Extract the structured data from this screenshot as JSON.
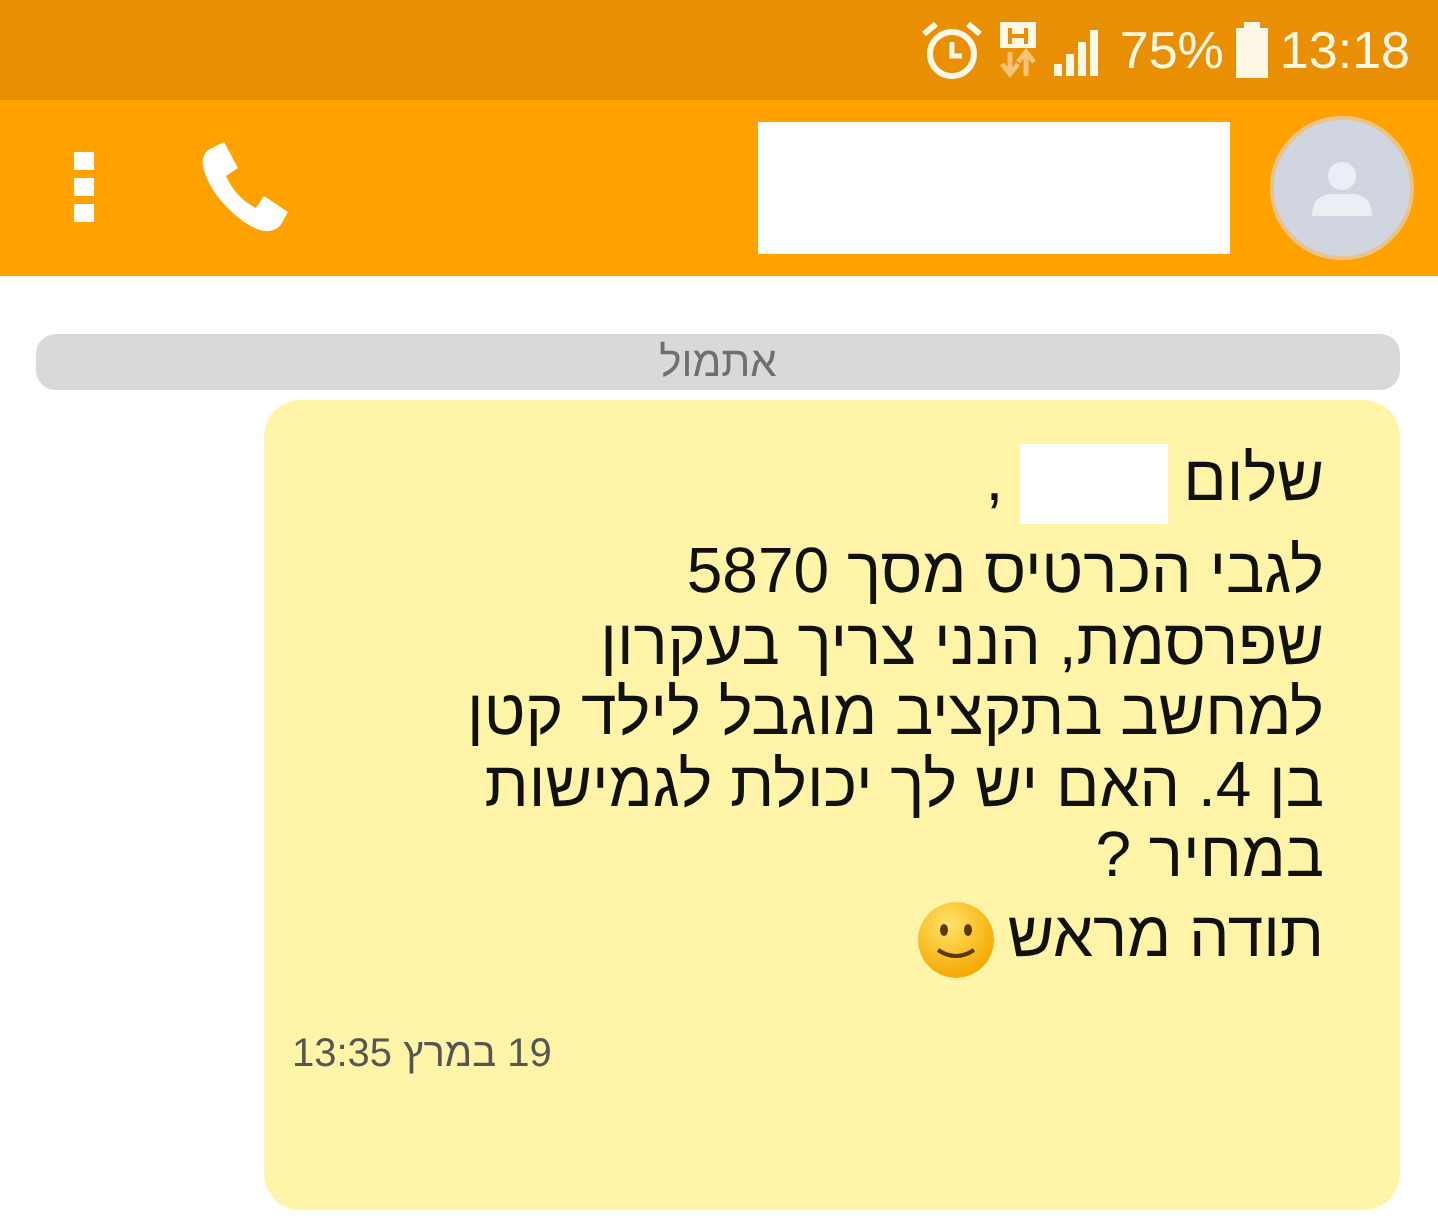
{
  "status_bar": {
    "battery_percent": "75%",
    "time": "13:18"
  },
  "date_divider": "אתמול",
  "message": {
    "greeting": "שלום",
    "greeting_punctuation": ",",
    "lines": [
      "לגבי הכרטיס מסך 5870",
      "שפרסמת, הנני צריך בעקרון",
      "למחשב בתקציב מוגבל לילד קטן",
      "בן 4. האם יש לך יכולת לגמישות",
      "במחיר ?"
    ],
    "closing": "תודה מראש",
    "timestamp": "19 במרץ 13:35"
  }
}
